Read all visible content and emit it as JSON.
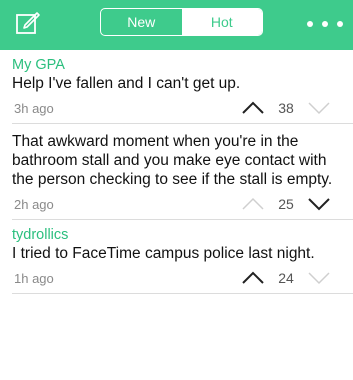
{
  "header": {
    "compose_icon": "compose-icon",
    "tabs": [
      {
        "label": "New",
        "active": false
      },
      {
        "label": "Hot",
        "active": true
      }
    ],
    "more_icon": "more-icon",
    "accent_color": "#3ecb8c"
  },
  "posts": [
    {
      "author": "My GPA",
      "text": "Help I've fallen and I can't get up.",
      "time": "3h ago",
      "votes": "38",
      "upvoted": true,
      "downvoted": false
    },
    {
      "author": "",
      "text": "That awkward moment when you're in the bathroom stall and you make eye contact with the person checking to see if the stall is empty.",
      "time": "2h ago",
      "votes": "25",
      "upvoted": false,
      "downvoted": true
    },
    {
      "author": "tydrollics",
      "text": "I tried to FaceTime campus police last night.",
      "time": "1h ago",
      "votes": "24",
      "upvoted": true,
      "downvoted": false
    }
  ]
}
